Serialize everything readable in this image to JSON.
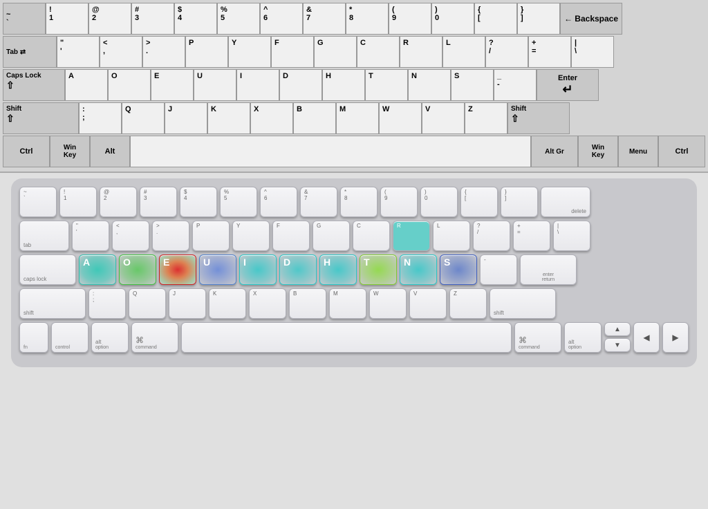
{
  "top_keyboard": {
    "rows": [
      {
        "keys": [
          {
            "chars": [
              "~",
              "`"
            ],
            "type": "std"
          },
          {
            "chars": [
              "!",
              "1"
            ],
            "type": "std"
          },
          {
            "chars": [
              "@",
              "2"
            ],
            "type": "std"
          },
          {
            "chars": [
              "#",
              "3"
            ],
            "type": "std"
          },
          {
            "chars": [
              "$",
              "4"
            ],
            "type": "std"
          },
          {
            "chars": [
              "%",
              "5"
            ],
            "type": "std"
          },
          {
            "chars": [
              "^",
              "6"
            ],
            "type": "std"
          },
          {
            "chars": [
              "&",
              "7"
            ],
            "type": "std"
          },
          {
            "chars": [
              "*",
              "8"
            ],
            "type": "std"
          },
          {
            "chars": [
              "(",
              "9"
            ],
            "type": "std"
          },
          {
            "chars": [
              ")",
              "0"
            ],
            "type": "std"
          },
          {
            "chars": [
              "{",
              "["
            ],
            "type": "std"
          },
          {
            "chars": [
              "}",
              "]"
            ],
            "type": "std"
          },
          {
            "chars": [
              "← Backspace"
            ],
            "type": "backspace"
          }
        ]
      },
      {
        "keys": [
          {
            "chars": [
              "Tab ⇥"
            ],
            "type": "tab"
          },
          {
            "chars": [
              "\"",
              "'"
            ],
            "type": "std"
          },
          {
            "chars": [
              "<",
              ","
            ],
            "type": "std"
          },
          {
            "chars": [
              ">",
              "."
            ],
            "type": "std"
          },
          {
            "chars": [
              "P"
            ],
            "type": "std"
          },
          {
            "chars": [
              "Y"
            ],
            "type": "std"
          },
          {
            "chars": [
              "F"
            ],
            "type": "std"
          },
          {
            "chars": [
              "G"
            ],
            "type": "std"
          },
          {
            "chars": [
              "C"
            ],
            "type": "std"
          },
          {
            "chars": [
              "R"
            ],
            "type": "std"
          },
          {
            "chars": [
              "L"
            ],
            "type": "std"
          },
          {
            "chars": [
              "?",
              "/"
            ],
            "type": "std"
          },
          {
            "chars": [
              "+",
              "="
            ],
            "type": "std"
          },
          {
            "chars": [
              "|",
              "\\"
            ],
            "type": "std"
          }
        ]
      },
      {
        "keys": [
          {
            "chars": [
              "Caps Lock",
              "⇑"
            ],
            "type": "caps"
          },
          {
            "chars": [
              "A"
            ],
            "type": "std"
          },
          {
            "chars": [
              "O"
            ],
            "type": "std"
          },
          {
            "chars": [
              "E"
            ],
            "type": "std"
          },
          {
            "chars": [
              "U"
            ],
            "type": "std"
          },
          {
            "chars": [
              "I"
            ],
            "type": "std"
          },
          {
            "chars": [
              "D"
            ],
            "type": "std"
          },
          {
            "chars": [
              "H"
            ],
            "type": "std"
          },
          {
            "chars": [
              "T"
            ],
            "type": "std"
          },
          {
            "chars": [
              "N"
            ],
            "type": "std"
          },
          {
            "chars": [
              "S"
            ],
            "type": "std"
          },
          {
            "chars": [
              "_",
              "-"
            ],
            "type": "std"
          },
          {
            "chars": [
              "Enter",
              "↵"
            ],
            "type": "enter"
          }
        ]
      },
      {
        "keys": [
          {
            "chars": [
              "Shift",
              "⇑"
            ],
            "type": "shift-l"
          },
          {
            "chars": [
              ":",
              ";"
            ],
            "type": "std"
          },
          {
            "chars": [
              "Q"
            ],
            "type": "std"
          },
          {
            "chars": [
              "J"
            ],
            "type": "std"
          },
          {
            "chars": [
              "K"
            ],
            "type": "std"
          },
          {
            "chars": [
              "X"
            ],
            "type": "std"
          },
          {
            "chars": [
              "B"
            ],
            "type": "std"
          },
          {
            "chars": [
              "M"
            ],
            "type": "std"
          },
          {
            "chars": [
              "W"
            ],
            "type": "std"
          },
          {
            "chars": [
              "V"
            ],
            "type": "std"
          },
          {
            "chars": [
              "Z"
            ],
            "type": "std"
          },
          {
            "chars": [
              "Shift",
              "⇑"
            ],
            "type": "shift-r"
          }
        ]
      },
      {
        "keys": [
          {
            "chars": [
              "Ctrl"
            ],
            "type": "ctrl"
          },
          {
            "chars": [
              "Win Key"
            ],
            "type": "win"
          },
          {
            "chars": [
              "Alt"
            ],
            "type": "alt"
          },
          {
            "chars": [
              ""
            ],
            "type": "space"
          },
          {
            "chars": [
              "Alt Gr"
            ],
            "type": "altgr"
          },
          {
            "chars": [
              "Win Key"
            ],
            "type": "win"
          },
          {
            "chars": [
              "Menu"
            ],
            "type": "menu"
          },
          {
            "chars": [
              "Ctrl"
            ],
            "type": "ctrl"
          }
        ]
      }
    ]
  },
  "bottom_keyboard": {
    "rows": [
      {
        "keys": [
          {
            "top": "~",
            "bot": "`",
            "type": "std"
          },
          {
            "top": "!",
            "bot": "1",
            "type": "std"
          },
          {
            "top": "@",
            "bot": "2",
            "type": "std"
          },
          {
            "top": "#",
            "bot": "3",
            "type": "std"
          },
          {
            "top": "$",
            "bot": "4",
            "type": "std"
          },
          {
            "top": "%",
            "bot": "5",
            "type": "std"
          },
          {
            "top": "^",
            "bot": "6",
            "type": "std"
          },
          {
            "top": "&",
            "bot": "7",
            "type": "std"
          },
          {
            "top": "*",
            "bot": "8",
            "type": "std"
          },
          {
            "top": "(",
            "bot": "9",
            "type": "std"
          },
          {
            "top": ")",
            "bot": "0",
            "type": "std"
          },
          {
            "top": "{",
            "bot": "[",
            "type": "std"
          },
          {
            "top": "}",
            "bot": "]",
            "type": "std"
          },
          {
            "label": "delete",
            "type": "delete"
          }
        ]
      },
      {
        "keys": [
          {
            "label": "tab",
            "type": "tab"
          },
          {
            "top": "\"",
            "bot": "'",
            "type": "std"
          },
          {
            "top": "<",
            "bot": ",",
            "type": "std"
          },
          {
            "top": ">",
            "bot": ".",
            "type": "std"
          },
          {
            "top": "P",
            "bot": "",
            "type": "std"
          },
          {
            "top": "Y",
            "bot": "",
            "type": "std"
          },
          {
            "top": "F",
            "bot": "",
            "type": "std"
          },
          {
            "top": "G",
            "bot": "",
            "type": "std"
          },
          {
            "top": "C",
            "bot": "",
            "type": "std"
          },
          {
            "top": "R",
            "bot": "",
            "type": "std",
            "heat": "cyan"
          },
          {
            "top": "L",
            "bot": "",
            "type": "std"
          },
          {
            "top": "?",
            "bot": "/",
            "type": "std"
          },
          {
            "top": "+",
            "bot": "=",
            "type": "std"
          },
          {
            "top": "|",
            "bot": "\\",
            "type": "std"
          }
        ]
      },
      {
        "keys": [
          {
            "label": "caps lock",
            "type": "caps"
          },
          {
            "top": "A",
            "bot": "",
            "type": "std",
            "heat": "cyan"
          },
          {
            "top": "O",
            "bot": "",
            "type": "std",
            "heat": "green"
          },
          {
            "top": "E",
            "bot": "",
            "type": "std",
            "heat": "red"
          },
          {
            "top": "U",
            "bot": "",
            "type": "std",
            "heat": "blue"
          },
          {
            "top": "I",
            "bot": "",
            "type": "std",
            "heat": "cyan"
          },
          {
            "top": "D",
            "bot": "",
            "type": "std",
            "heat": "cyan"
          },
          {
            "top": "H",
            "bot": "",
            "type": "std",
            "heat": "cyan"
          },
          {
            "top": "T",
            "bot": "",
            "type": "std",
            "heat": "yellow"
          },
          {
            "top": "N",
            "bot": "",
            "type": "std",
            "heat": "cyan"
          },
          {
            "top": "S",
            "bot": "",
            "type": "std",
            "heat": "blue"
          },
          {
            "top": "-",
            "bot": "",
            "type": "std"
          },
          {
            "label": "enter\nreturn",
            "type": "enter"
          }
        ]
      },
      {
        "keys": [
          {
            "label": "shift",
            "type": "shift-l"
          },
          {
            "top": ":",
            "bot": ";",
            "type": "std"
          },
          {
            "top": "Q",
            "bot": "",
            "type": "std"
          },
          {
            "top": "J",
            "bot": "",
            "type": "std"
          },
          {
            "top": "K",
            "bot": "",
            "type": "std"
          },
          {
            "top": "X",
            "bot": "",
            "type": "std"
          },
          {
            "top": "B",
            "bot": "",
            "type": "std"
          },
          {
            "top": "M",
            "bot": "",
            "type": "std"
          },
          {
            "top": "W",
            "bot": "",
            "type": "std"
          },
          {
            "top": "V",
            "bot": "",
            "type": "std"
          },
          {
            "top": "Z",
            "bot": "",
            "type": "std"
          },
          {
            "label": "shift",
            "type": "shift-r"
          }
        ]
      },
      {
        "keys": [
          {
            "label": "fn",
            "type": "fn"
          },
          {
            "label": "control",
            "type": "ctrl-m"
          },
          {
            "label": "alt\noption",
            "type": "alt-m"
          },
          {
            "label": "⌘\ncommand",
            "type": "cmd"
          },
          {
            "label": "",
            "type": "space"
          },
          {
            "label": "⌘\ncommand",
            "type": "cmd"
          },
          {
            "label": "alt\noption",
            "type": "alt-m"
          },
          {
            "label": "◀",
            "type": "arrow"
          },
          {
            "label": "▲▼",
            "type": "arrow-ud"
          },
          {
            "label": "▶",
            "type": "arrow"
          }
        ]
      }
    ]
  }
}
